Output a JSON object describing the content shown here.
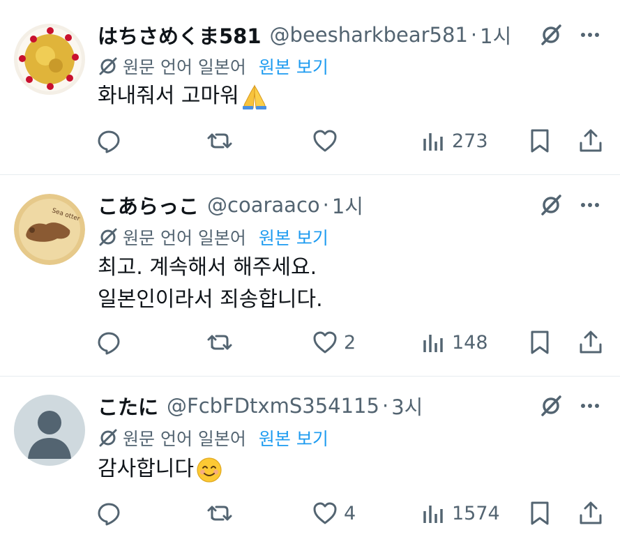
{
  "tweets": [
    {
      "name": "はちさめくま581",
      "handle": "@beesharkbear581",
      "time": "1시",
      "translate_label": "원문 언어 일본어",
      "translate_link": "원본 보기",
      "text_lines": [
        "화내줘서 고마워"
      ],
      "emoji": "folded-hands",
      "replies": "",
      "retweets": "",
      "likes": "",
      "views": "273"
    },
    {
      "name": "こあらっこ",
      "handle": "@coaraaco",
      "time": "1시",
      "translate_label": "원문 언어 일본어",
      "translate_link": "원본 보기",
      "text_lines": [
        "최고. 계속해서 해주세요.",
        "일본인이라서 죄송합니다."
      ],
      "emoji": "",
      "replies": "",
      "retweets": "",
      "likes": "2",
      "views": "148"
    },
    {
      "name": "こたに",
      "handle": "@FcbFDtxmS354115",
      "time": "3시",
      "translate_label": "원문 언어 일본어",
      "translate_link": "원본 보기",
      "text_lines": [
        "감사합니다"
      ],
      "emoji": "smiling-face",
      "replies": "",
      "retweets": "",
      "likes": "4",
      "views": "1574"
    }
  ],
  "separator": "·",
  "colors": {
    "text": "#0f1419",
    "secondary": "#536471",
    "link": "#1d9bf0",
    "border": "#eff3f4"
  }
}
